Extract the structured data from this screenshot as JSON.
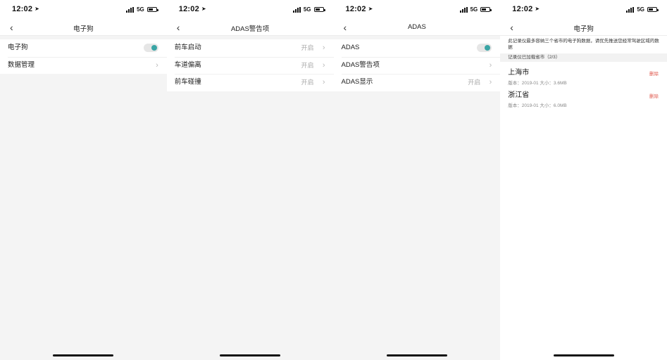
{
  "status_bar": {
    "time": "12:02",
    "network": "5G"
  },
  "screens": [
    {
      "title": "电子狗",
      "rows": [
        {
          "label": "电子狗",
          "toggle_on": true
        },
        {
          "label": "数据管理"
        }
      ]
    },
    {
      "title": "ADAS警告项",
      "rows": [
        {
          "label": "前车启动",
          "value": "开启"
        },
        {
          "label": "车道偏离",
          "value": "开启"
        },
        {
          "label": "前车碰撞",
          "value": "开启"
        }
      ]
    },
    {
      "title": "ADAS",
      "rows": [
        {
          "label": "ADAS",
          "toggle_on": true
        },
        {
          "label": "ADAS警告项"
        },
        {
          "label": "ADAS显示",
          "value": "开启"
        }
      ]
    },
    {
      "title": "电子狗",
      "notice": "此记录仪最多容纳三个省市的电子狗数据，请优先推送您经常驾驶区域的数据",
      "section_header": "记录仪已加载省市（2/3）",
      "items": [
        {
          "name": "上海市",
          "meta": "版本：2019-01   大小：3.6MB",
          "action": "删除"
        },
        {
          "name": "浙江省",
          "meta": "版本：2019-01   大小：6.0MB",
          "action": "删除"
        }
      ]
    }
  ],
  "colors": {
    "accent": "#3aa5a5",
    "delete": "#e05a4f",
    "background": "#f4f4f4"
  },
  "icons": [
    "location-arrow-icon",
    "signal-icon",
    "battery-icon",
    "back-arrow-icon",
    "chevron-right-icon"
  ]
}
